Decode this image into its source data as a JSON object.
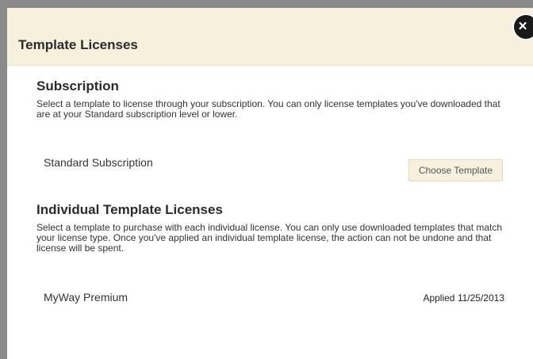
{
  "dialog": {
    "title": "Template Licenses",
    "close_label": "×"
  },
  "subscription": {
    "heading": "Subscription",
    "description": "Select a template to license through your subscription. You can only license templates you've downloaded that are at your Standard subscription level or lower.",
    "license_name": "Standard Subscription",
    "button_label": "Choose Template"
  },
  "individual": {
    "heading": "Individual Template Licenses",
    "description": "Select a template to purchase with each individual license. You can only use downloaded templates that match your license type. Once you've applied an individual template license, the action can not be undone and that license will be spent.",
    "license_name": "MyWay Premium",
    "status": "Applied 11/25/2013"
  },
  "colors": {
    "header_bg": "#f6f0dc",
    "button_bg": "#f6f0dc",
    "frame": "#8a8a8a"
  }
}
